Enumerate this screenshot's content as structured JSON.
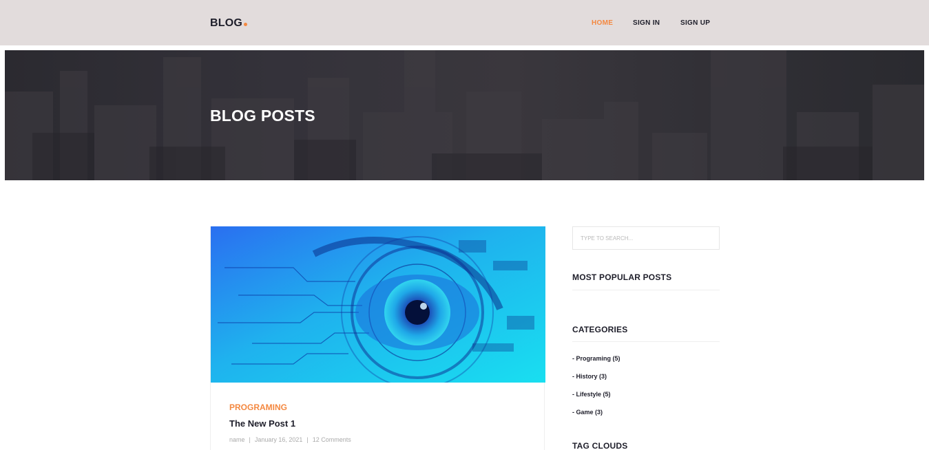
{
  "header": {
    "logo": "BLOG",
    "nav": [
      {
        "label": "HOME",
        "active": true
      },
      {
        "label": "SIGN IN",
        "active": false
      },
      {
        "label": "SIGN UP",
        "active": false
      }
    ]
  },
  "hero": {
    "title": "BLOG POSTS"
  },
  "post": {
    "category": "PROGRAMING",
    "title": "The New Post 1",
    "author": "name",
    "date": "January 16, 2021",
    "comments": "12 Comments"
  },
  "sidebar": {
    "search_placeholder": "TYPE TO SEARCH...",
    "popular_heading": "MOST POPULAR POSTS",
    "categories_heading": "CATEGORIES",
    "categories": [
      "- Programing (5)",
      "- History (3)",
      "- Lifestyle (5)",
      "- Game (3)"
    ],
    "tags_heading": "TAG CLOUDS"
  },
  "colors": {
    "accent": "#f48840",
    "header_bg": "#e2dcdc",
    "text_dark": "#1e1e2a"
  }
}
